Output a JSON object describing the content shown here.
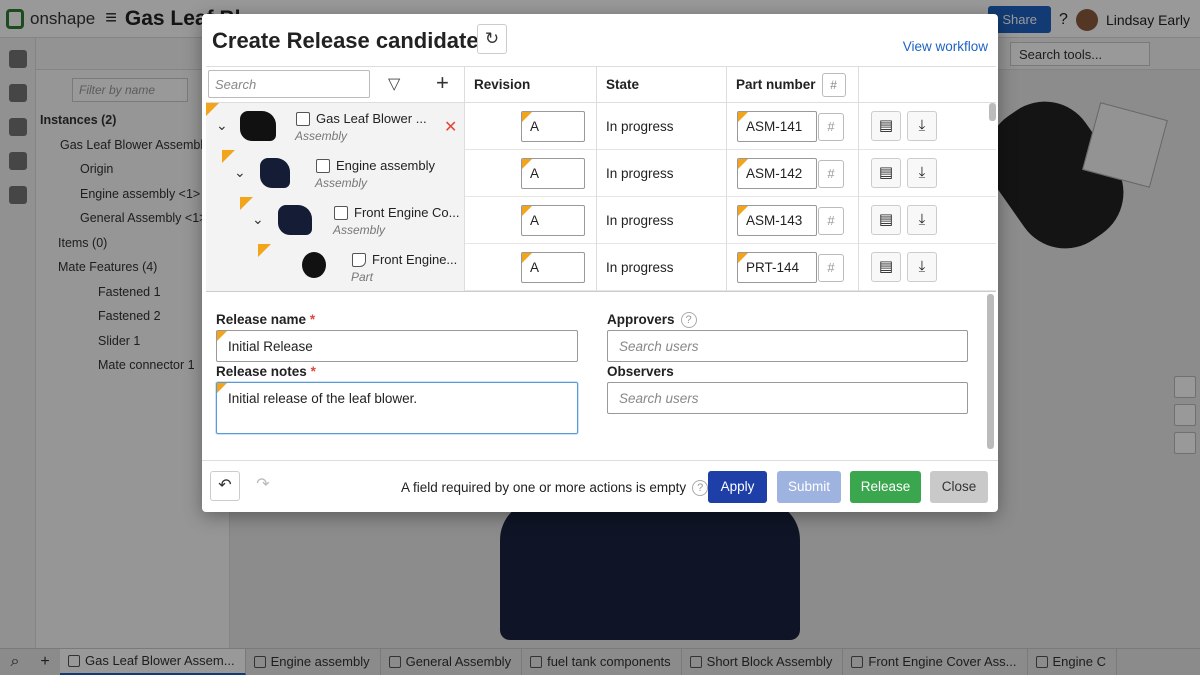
{
  "app": {
    "brand": "onshape",
    "doc_title": "Gas Leaf Bl",
    "share_label": "Share",
    "user_name": "Lindsay Early",
    "search_tools": "Search tools...",
    "filter_placeholder": "Filter by name",
    "feature_items": [
      "Instances (2)",
      "Gas Leaf Blower Assembly",
      "Origin",
      "Engine assembly <1>",
      "General Assembly <1>",
      "Items (0)",
      "Mate Features (4)",
      "Fastened 1",
      "Fastened 2",
      "Slider 1",
      "Mate connector 1"
    ],
    "bottom_tabs": [
      "Gas Leaf Blower Assem...",
      "Engine assembly",
      "General Assembly",
      "fuel tank components",
      "Short Block Assembly",
      "Front Engine Cover Ass...",
      "Engine C"
    ]
  },
  "modal": {
    "title": "Create Release candidate",
    "view_workflow": "View workflow",
    "search_placeholder": "Search",
    "columns": {
      "revision": "Revision",
      "state": "State",
      "part_number": "Part number"
    },
    "rows": [
      {
        "name": "Gas Leaf Blower ...",
        "type": "Assembly",
        "revision": "A",
        "state": "In progress",
        "part_number": "ASM-141"
      },
      {
        "name": "Engine assembly",
        "type": "Assembly",
        "revision": "A",
        "state": "In progress",
        "part_number": "ASM-142"
      },
      {
        "name": "Front Engine Co...",
        "type": "Assembly",
        "revision": "A",
        "state": "In progress",
        "part_number": "ASM-143"
      },
      {
        "name": "Front Engine...",
        "type": "Part",
        "revision": "A",
        "state": "In progress",
        "part_number": "PRT-144"
      }
    ],
    "form": {
      "release_name_label": "Release name",
      "release_name_value": "Initial Release",
      "release_notes_label": "Release notes",
      "release_notes_value": "Initial release of the leaf blower.",
      "approvers_label": "Approvers",
      "approvers_placeholder": "Search users",
      "observers_label": "Observers",
      "observers_placeholder": "Search users",
      "required_mark": "*"
    },
    "footer": {
      "message": "A field required by one or more actions is empty",
      "apply": "Apply",
      "submit": "Submit",
      "release": "Release",
      "close": "Close"
    }
  },
  "colors": {
    "accent_blue": "#1e63c4",
    "apply_blue": "#1e3fa8",
    "release_green": "#3aa74e",
    "required_flag": "#f2a51a",
    "remove_red": "#e0483a"
  }
}
